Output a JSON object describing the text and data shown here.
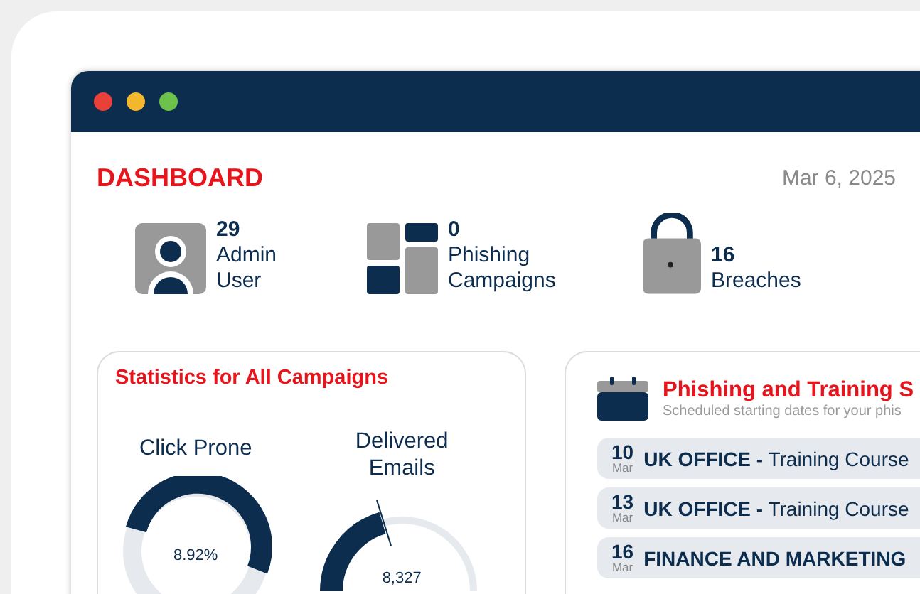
{
  "page_title": "DASHBOARD",
  "date": "Mar 6, 2025",
  "stats": [
    {
      "kind": "user",
      "value": "29",
      "label": [
        "Admin",
        "User"
      ]
    },
    {
      "kind": "campaigns",
      "value": "0",
      "label": [
        "Phishing",
        "Campaigns"
      ]
    },
    {
      "kind": "lock",
      "value": "16",
      "label": [
        "Breaches"
      ]
    }
  ],
  "statistics": {
    "title": "Statistics for All Campaigns",
    "gauges": [
      {
        "kind": "ring",
        "title": [
          "Click Prone"
        ],
        "reading": "8.92%"
      },
      {
        "kind": "half",
        "title": [
          "Delivered",
          "Emails"
        ],
        "reading": "8,327"
      }
    ]
  },
  "schedule": {
    "title": "Phishing and Training S",
    "subtitle": "Scheduled starting dates for your phis",
    "items": [
      {
        "day": "10",
        "month": "Mar",
        "text": "**UK OFFICE -** Training Course"
      },
      {
        "day": "13",
        "month": "Mar",
        "text": "**UK OFFICE -** Training Course"
      },
      {
        "day": "16",
        "month": "Mar",
        "text": "**FINANCE AND MARKETING**"
      }
    ]
  }
}
